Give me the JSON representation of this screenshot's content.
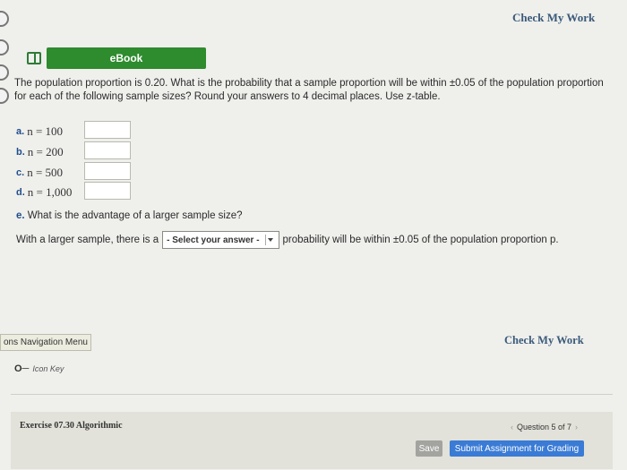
{
  "header": {
    "check_my_work": "Check My Work"
  },
  "ebook": {
    "label": "eBook",
    "icon": "book-icon"
  },
  "question": {
    "text": "The population proportion is 0.20. What is the probability that a sample proportion will be within ±0.05 of the population proportion for each of the following sample sizes? Round your answers to 4 decimal places. Use z-table."
  },
  "parts": [
    {
      "label": "a.",
      "expr": "n = 100",
      "answer": ""
    },
    {
      "label": "b.",
      "expr": "n = 200",
      "answer": ""
    },
    {
      "label": "c.",
      "expr": "n = 500",
      "answer": ""
    },
    {
      "label": "d.",
      "expr": "n = 1,000",
      "answer": ""
    }
  ],
  "part_e": {
    "label": "e.",
    "question": "What is the advantage of a larger sample size?",
    "sentence_before": "With a larger sample, there is a",
    "select_value": "- Select your answer -",
    "sentence_after": "probability will be within ±0.05 of the population proportion p."
  },
  "navigation": {
    "menu_label": "ons Navigation Menu",
    "check_my_work": "Check My Work",
    "icon_key": "Icon Key",
    "icon_key_glyph": "O─"
  },
  "footer": {
    "exercise": "Exercise 07.30 Algorithmic",
    "question_nav": "Question 5 of 7",
    "save": "Save",
    "submit": "Submit Assignment for Grading"
  },
  "colors": {
    "ebook_green": "#2e8b2e",
    "submit_blue": "#3a7bd5",
    "part_label_blue": "#1f4e8a"
  }
}
